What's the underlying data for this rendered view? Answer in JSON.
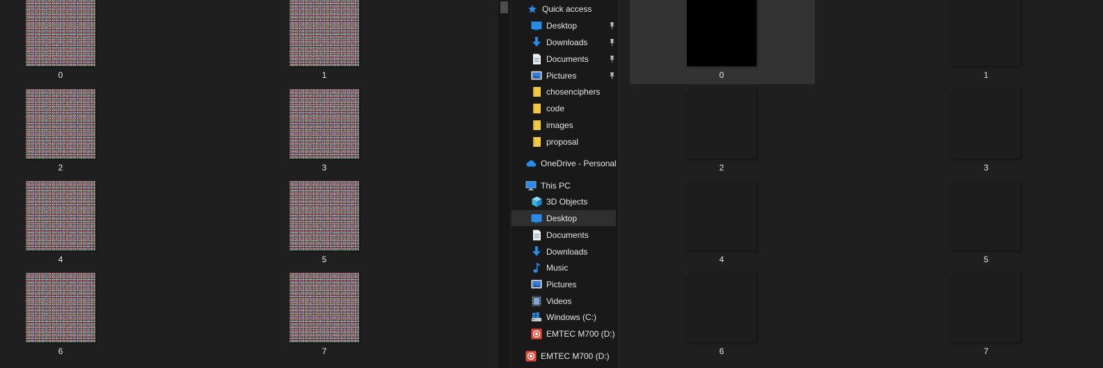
{
  "left_window": {
    "tiles": [
      {
        "label": "0"
      },
      {
        "label": "1"
      },
      {
        "label": "2"
      },
      {
        "label": "3"
      },
      {
        "label": "4"
      },
      {
        "label": "5"
      },
      {
        "label": "6"
      },
      {
        "label": "7"
      }
    ]
  },
  "nav": {
    "quick_access": "Quick access",
    "qa_items": [
      {
        "label": "Desktop",
        "icon": "desktop-icon",
        "pinned": true
      },
      {
        "label": "Downloads",
        "icon": "downloads-icon",
        "pinned": true
      },
      {
        "label": "Documents",
        "icon": "documents-icon",
        "pinned": true
      },
      {
        "label": "Pictures",
        "icon": "pictures-icon",
        "pinned": true
      },
      {
        "label": "chosenciphers",
        "icon": "folder-icon",
        "pinned": false
      },
      {
        "label": "code",
        "icon": "folder-icon",
        "pinned": false
      },
      {
        "label": "images",
        "icon": "folder-icon",
        "pinned": false
      },
      {
        "label": "proposal",
        "icon": "folder-icon",
        "pinned": false
      }
    ],
    "onedrive": "OneDrive - Personal",
    "this_pc": "This PC",
    "pc_items": [
      {
        "label": "3D Objects",
        "icon": "3d-objects-icon"
      },
      {
        "label": "Desktop",
        "icon": "desktop-icon"
      },
      {
        "label": "Documents",
        "icon": "documents-icon"
      },
      {
        "label": "Downloads",
        "icon": "downloads-icon"
      },
      {
        "label": "Music",
        "icon": "music-icon"
      },
      {
        "label": "Pictures",
        "icon": "pictures-icon"
      },
      {
        "label": "Videos",
        "icon": "videos-icon"
      },
      {
        "label": "Windows (C:)",
        "icon": "drive-c-icon"
      },
      {
        "label": "EMTEC M700 (D:)",
        "icon": "usb-drive-icon"
      }
    ],
    "usb_root": "EMTEC M700 (D:)",
    "selected": "Desktop",
    "colors": {
      "accent": "#2b8ae6",
      "folder": "#f0c94a",
      "usb": "#e04b3c"
    }
  },
  "right_window": {
    "tiles": [
      {
        "label": "0"
      },
      {
        "label": "1"
      },
      {
        "label": "2"
      },
      {
        "label": "3"
      },
      {
        "label": "4"
      },
      {
        "label": "5"
      },
      {
        "label": "6"
      },
      {
        "label": "7"
      }
    ]
  }
}
